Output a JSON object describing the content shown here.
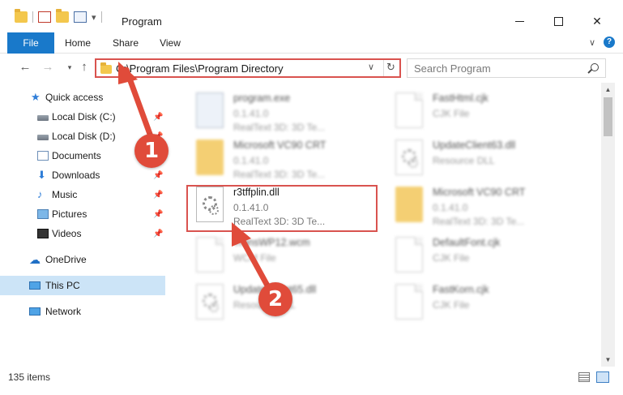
{
  "window": {
    "title": "Program",
    "qat_icons": [
      "folder-icon",
      "checkmark-icon",
      "folder-icon",
      "properties-icon"
    ]
  },
  "ribbon": {
    "tabs": [
      "File",
      "Home",
      "Share",
      "View"
    ],
    "help_label": "?"
  },
  "address": {
    "path": "C:\\Program Files\\Program Directory"
  },
  "search": {
    "placeholder": "Search Program"
  },
  "sidebar": {
    "items": [
      {
        "label": "Quick access",
        "icon": "star-icon",
        "pinned": false
      },
      {
        "label": "Local Disk (C:)",
        "icon": "disk-icon",
        "pinned": true
      },
      {
        "label": "Local Disk (D:)",
        "icon": "disk-icon",
        "pinned": true
      },
      {
        "label": "Documents",
        "icon": "documents-icon",
        "pinned": true
      },
      {
        "label": "Downloads",
        "icon": "downloads-icon",
        "pinned": true
      },
      {
        "label": "Music",
        "icon": "music-icon",
        "pinned": true
      },
      {
        "label": "Pictures",
        "icon": "pictures-icon",
        "pinned": true
      },
      {
        "label": "Videos",
        "icon": "videos-icon",
        "pinned": true
      },
      {
        "label": "OneDrive",
        "icon": "cloud-icon",
        "pinned": false
      },
      {
        "label": "This PC",
        "icon": "computer-icon",
        "pinned": false,
        "selected": true
      },
      {
        "label": "Network",
        "icon": "network-icon",
        "pinned": false
      }
    ]
  },
  "files": [
    {
      "name": "program.exe",
      "meta1": "0.1.41.0",
      "meta2": "RealText 3D:  3D Te...",
      "icon": "exe-file-icon",
      "col": 0,
      "row": 0
    },
    {
      "name": "FastHtml.cjk",
      "meta1": "CJK File",
      "meta2": "",
      "icon": "blank-file-icon",
      "col": 1,
      "row": 0
    },
    {
      "name": "Microsoft VC90 CRT",
      "meta1": "0.1.41.0",
      "meta2": "RealText 3D:  3D Te...",
      "icon": "folder-file-icon",
      "col": 0,
      "row": 1
    },
    {
      "name": "UpdateClient63.dll",
      "meta1": "Resource DLL",
      "meta2": "",
      "icon": "dll-file-icon",
      "col": 1,
      "row": 1
    },
    {
      "name": "r3tffplin.dll",
      "meta1": "0.1.41.0",
      "meta2": "RealText 3D:  3D Te...",
      "icon": "dll-file-icon",
      "col": 0,
      "row": 2,
      "highlighted": true
    },
    {
      "name": "Microsoft VC90 CRT",
      "meta1": "0.1.41.0",
      "meta2": "RealText 3D:  3D Te...",
      "icon": "folder-file-icon",
      "col": 1,
      "row": 2
    },
    {
      "name": "TransWP12.wcm",
      "meta1": "WCM File",
      "meta2": "",
      "icon": "blank-file-icon",
      "col": 0,
      "row": 3
    },
    {
      "name": "DefaultFont.cjk",
      "meta1": "CJK File",
      "meta2": "",
      "icon": "blank-file-icon",
      "col": 1,
      "row": 3
    },
    {
      "name": "UpdateClient65.dll",
      "meta1": "Resource DLL",
      "meta2": "",
      "icon": "dll-file-icon",
      "col": 0,
      "row": 4
    },
    {
      "name": "FastKorn.cjk",
      "meta1": "CJK File",
      "meta2": "",
      "icon": "blank-file-icon",
      "col": 1,
      "row": 4
    }
  ],
  "status": {
    "item_count": "135 items"
  },
  "annotations": {
    "callout_1": "1",
    "callout_2": "2",
    "accent_color": "#e04b3a"
  },
  "colors": {
    "file_tab": "#1979ca",
    "selected_nav": "#cce4f7",
    "highlight_border": "#d9534f"
  }
}
